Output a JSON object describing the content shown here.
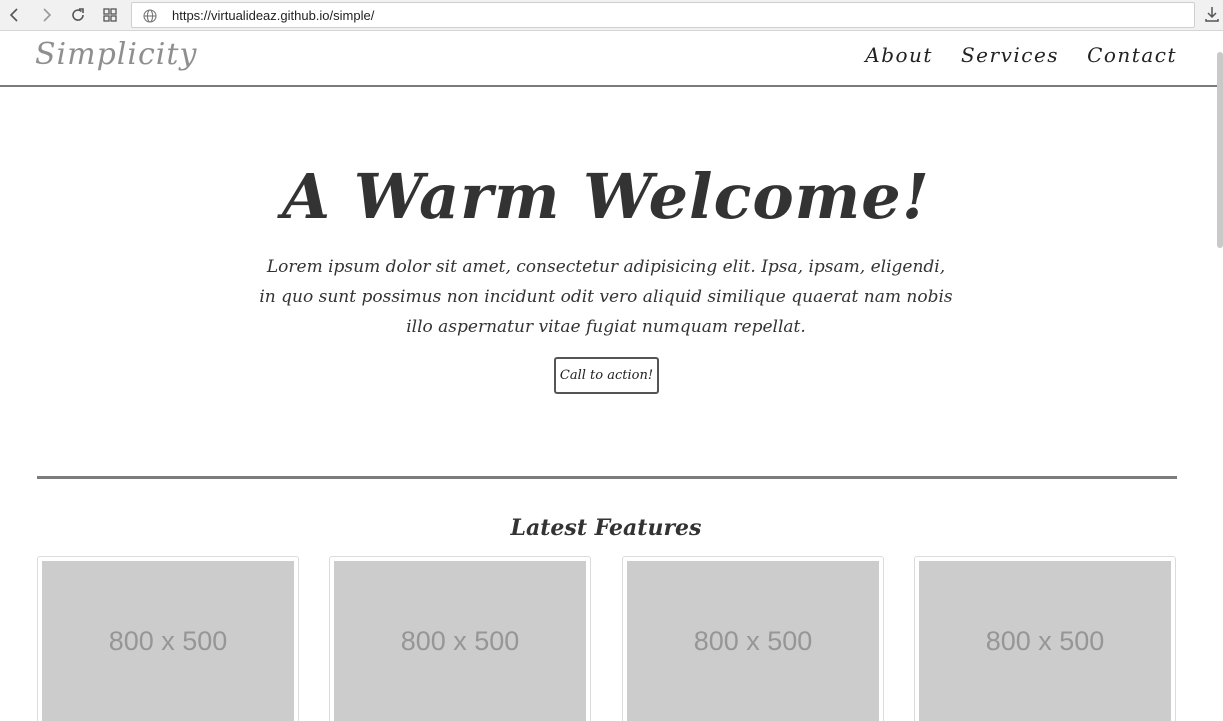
{
  "browser": {
    "url": "https://virtualideaz.github.io/simple/"
  },
  "navbar": {
    "brand": "Simplicity",
    "links": [
      "About",
      "Services",
      "Contact"
    ]
  },
  "hero": {
    "title": "A Warm Welcome!",
    "text": "Lorem ipsum dolor sit amet, consectetur adipisicing elit. Ipsa, ipsam, eligendi, in quo sunt possimus non incidunt odit vero aliquid similique quaerat nam nobis illo aspernatur vitae fugiat numquam repellat.",
    "cta": "Call to action!"
  },
  "features": {
    "heading": "Latest Features",
    "cards": [
      {
        "image_label": "800 x 500"
      },
      {
        "image_label": "800 x 500"
      },
      {
        "image_label": "800 x 500"
      },
      {
        "image_label": "800 x 500"
      }
    ]
  }
}
